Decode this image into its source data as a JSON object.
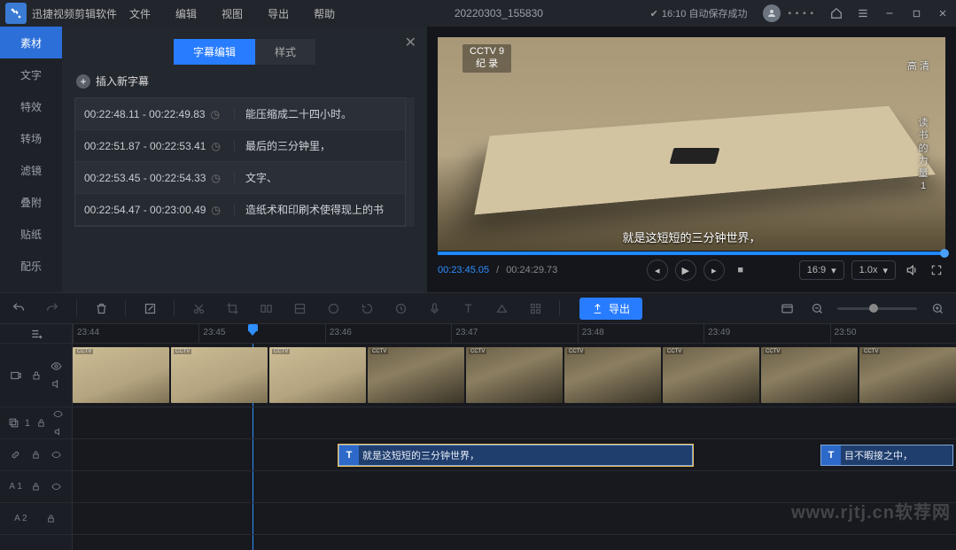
{
  "titlebar": {
    "app_name": "迅捷视频剪辑软件",
    "menus": [
      "文件",
      "编辑",
      "视图",
      "导出",
      "帮助"
    ],
    "document": "20220303_155830",
    "autosave": "16:10 自动保存成功",
    "level": "▪ ▪ ▪ ▪"
  },
  "nav": {
    "items": [
      "素材",
      "文字",
      "特效",
      "转场",
      "滤镜",
      "叠附",
      "贴纸",
      "配乐"
    ]
  },
  "panel": {
    "tabs": {
      "edit": "字幕编辑",
      "style": "样式"
    },
    "insert": "插入新字幕",
    "rows": [
      {
        "time": "00:22:48.11 - 00:22:49.83",
        "text": "能压缩成二十四小时。"
      },
      {
        "time": "00:22:51.87 - 00:22:53.41",
        "text": "最后的三分钟里，"
      },
      {
        "time": "00:22:53.45 - 00:22:54.33",
        "text": "文字、"
      },
      {
        "time": "00:22:54.47 - 00:23:00.49",
        "text": "造纸术和印刷术使得现上的书"
      }
    ]
  },
  "preview": {
    "channel": "CCTV 9",
    "channel_sub": "纪 录",
    "hd": "高 清",
    "side_title": "读书的力量 1",
    "caption": "就是这短短的三分钟世界，",
    "time_current": "00:23:45.05",
    "time_total": "00:24:29.73",
    "aspect": "16:9",
    "speed": "1.0x"
  },
  "toolbar": {
    "export": "导出"
  },
  "ruler": [
    "23:44",
    "23:45",
    "23:46",
    "23:47",
    "23:48",
    "23:49",
    "23:50"
  ],
  "tracks": {
    "t1_label": "1",
    "t2_label": "1",
    "ta1_label": "A 1",
    "ta2_label": "A 2",
    "sub_clip_1": "就是这短短的三分钟世界，",
    "sub_clip_2": "目不暇接之中，",
    "clip_icon": "T"
  },
  "watermark": "www.rjtj.cn软荐网"
}
